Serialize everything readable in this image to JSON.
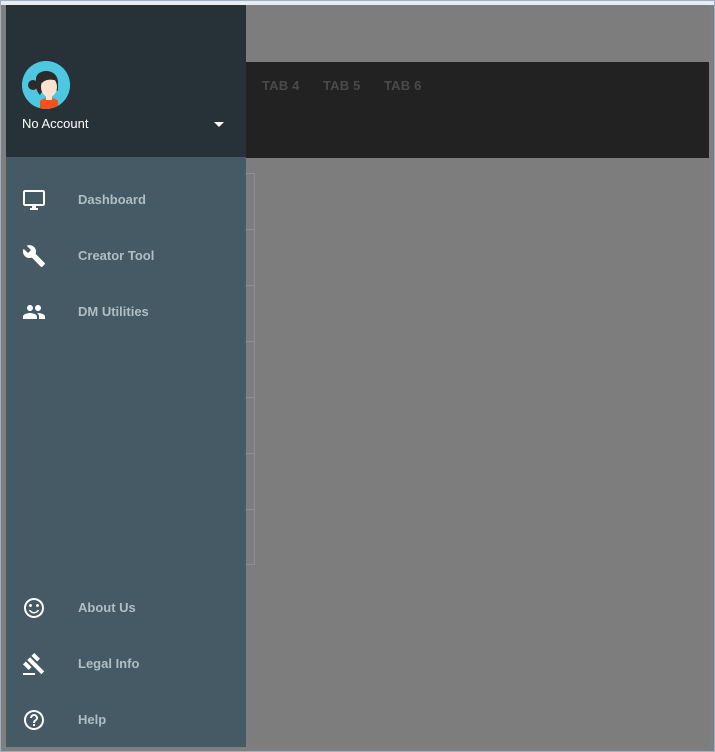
{
  "account": {
    "name": "No Account"
  },
  "tabs": [
    {
      "label": "TAB 4"
    },
    {
      "label": "TAB 5"
    },
    {
      "label": "TAB 6"
    }
  ],
  "nav": {
    "primary": [
      {
        "label": "Dashboard",
        "icon": "monitor-icon"
      },
      {
        "label": "Creator Tool",
        "icon": "wrench-icon"
      },
      {
        "label": "DM Utilities",
        "icon": "people-icon"
      }
    ],
    "secondary": [
      {
        "label": "About Us",
        "icon": "smiley-icon"
      },
      {
        "label": "Legal Info",
        "icon": "gavel-icon"
      },
      {
        "label": "Help",
        "icon": "help-icon"
      }
    ]
  },
  "colors": {
    "drawer_bg": "#455a64",
    "drawer_header_bg": "#263238",
    "tabbar_bg": "#222222",
    "overlay_bg": "#7d7d7d",
    "nav_text": "#b0bec5"
  }
}
